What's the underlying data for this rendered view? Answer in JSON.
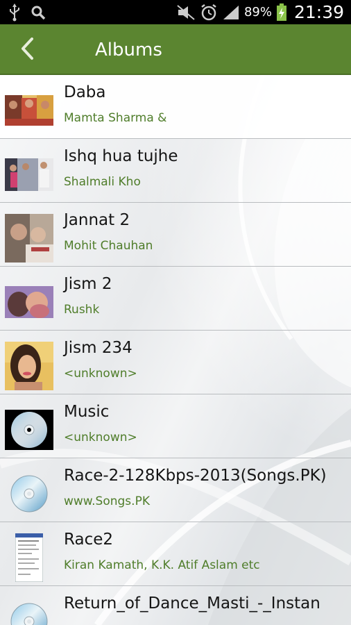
{
  "status_bar": {
    "icons_left": [
      "usb-icon",
      "search-icon"
    ],
    "icons_right": [
      "mute-icon",
      "alarm-icon",
      "signal-icon",
      "battery-charging-icon"
    ],
    "battery": "89%",
    "time": "21:39"
  },
  "action_bar": {
    "title": "Albums",
    "back_icon": "chevron-left-icon",
    "color": "#5b8530"
  },
  "albums": [
    {
      "title": "Daba",
      "subtitle": "Mamta Sharma &",
      "art": "photo-collage"
    },
    {
      "title": "Ishq hua tujhe",
      "subtitle": "Shalmali Kho",
      "art": "photo-people"
    },
    {
      "title": "Jannat 2",
      "subtitle": "Mohit Chauhan",
      "art": "photo-poster"
    },
    {
      "title": "Jism 2",
      "subtitle": "Rushk",
      "art": "photo-couple"
    },
    {
      "title": "Jism 234",
      "subtitle": "<unknown>",
      "art": "photo-portrait"
    },
    {
      "title": "Music",
      "subtitle": "<unknown>",
      "art": "cd-dark"
    },
    {
      "title": "Race-2-128Kbps-2013(Songs.PK)",
      "subtitle": "www.Songs.PK",
      "art": "cd-icon"
    },
    {
      "title": "Race2",
      "subtitle": "Kiran Kamath, K.K. Atif Aslam etc",
      "art": "document-thumb"
    },
    {
      "title": "Return_of_Dance_Masti_-_Instan",
      "subtitle": "",
      "art": "cd-icon"
    }
  ],
  "colors": {
    "subtitle": "#4f7d2a",
    "divider": "#b9bcbf"
  }
}
